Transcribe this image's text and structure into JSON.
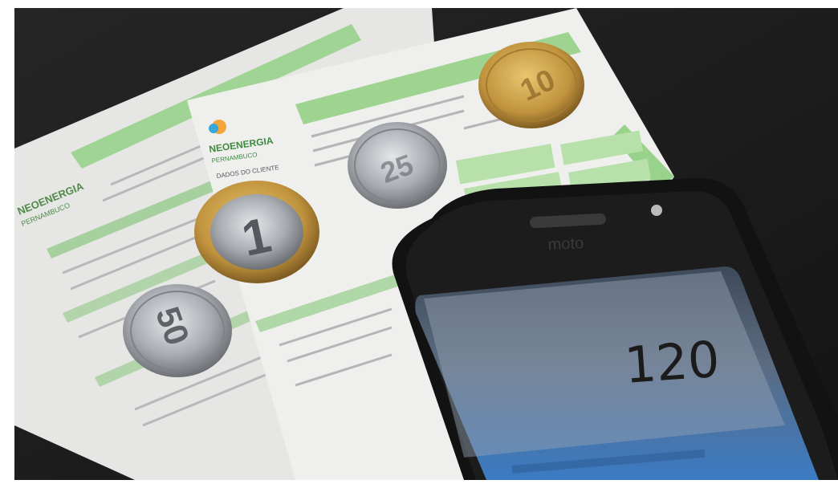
{
  "photo": {
    "description_type": "photo",
    "colors": {
      "table": "#1f1f1f",
      "bill_paper": "#ececec",
      "bill_green": "#7cc26f",
      "coin_silver": "#b9bcc0",
      "coin_gold": "#c79a4a",
      "phone_body": "#141414",
      "phone_screen": "#4f6178",
      "display_text": "#1b1b1b"
    }
  },
  "bill_front": {
    "brand": "NEOENERGIA",
    "subbrand": "PERNAMBUCO",
    "client_section": "DADOS DO CLIENTE"
  },
  "bill_back": {
    "brand": "NEOENERGIA",
    "subbrand": "PERNAMBUCO"
  },
  "coins": {
    "one_real": "1",
    "fifty_centavos": "50",
    "twenty_five_centavos": "25",
    "ten_centavos": "10"
  },
  "phone": {
    "brand": "moto",
    "calculator_display": "120"
  }
}
